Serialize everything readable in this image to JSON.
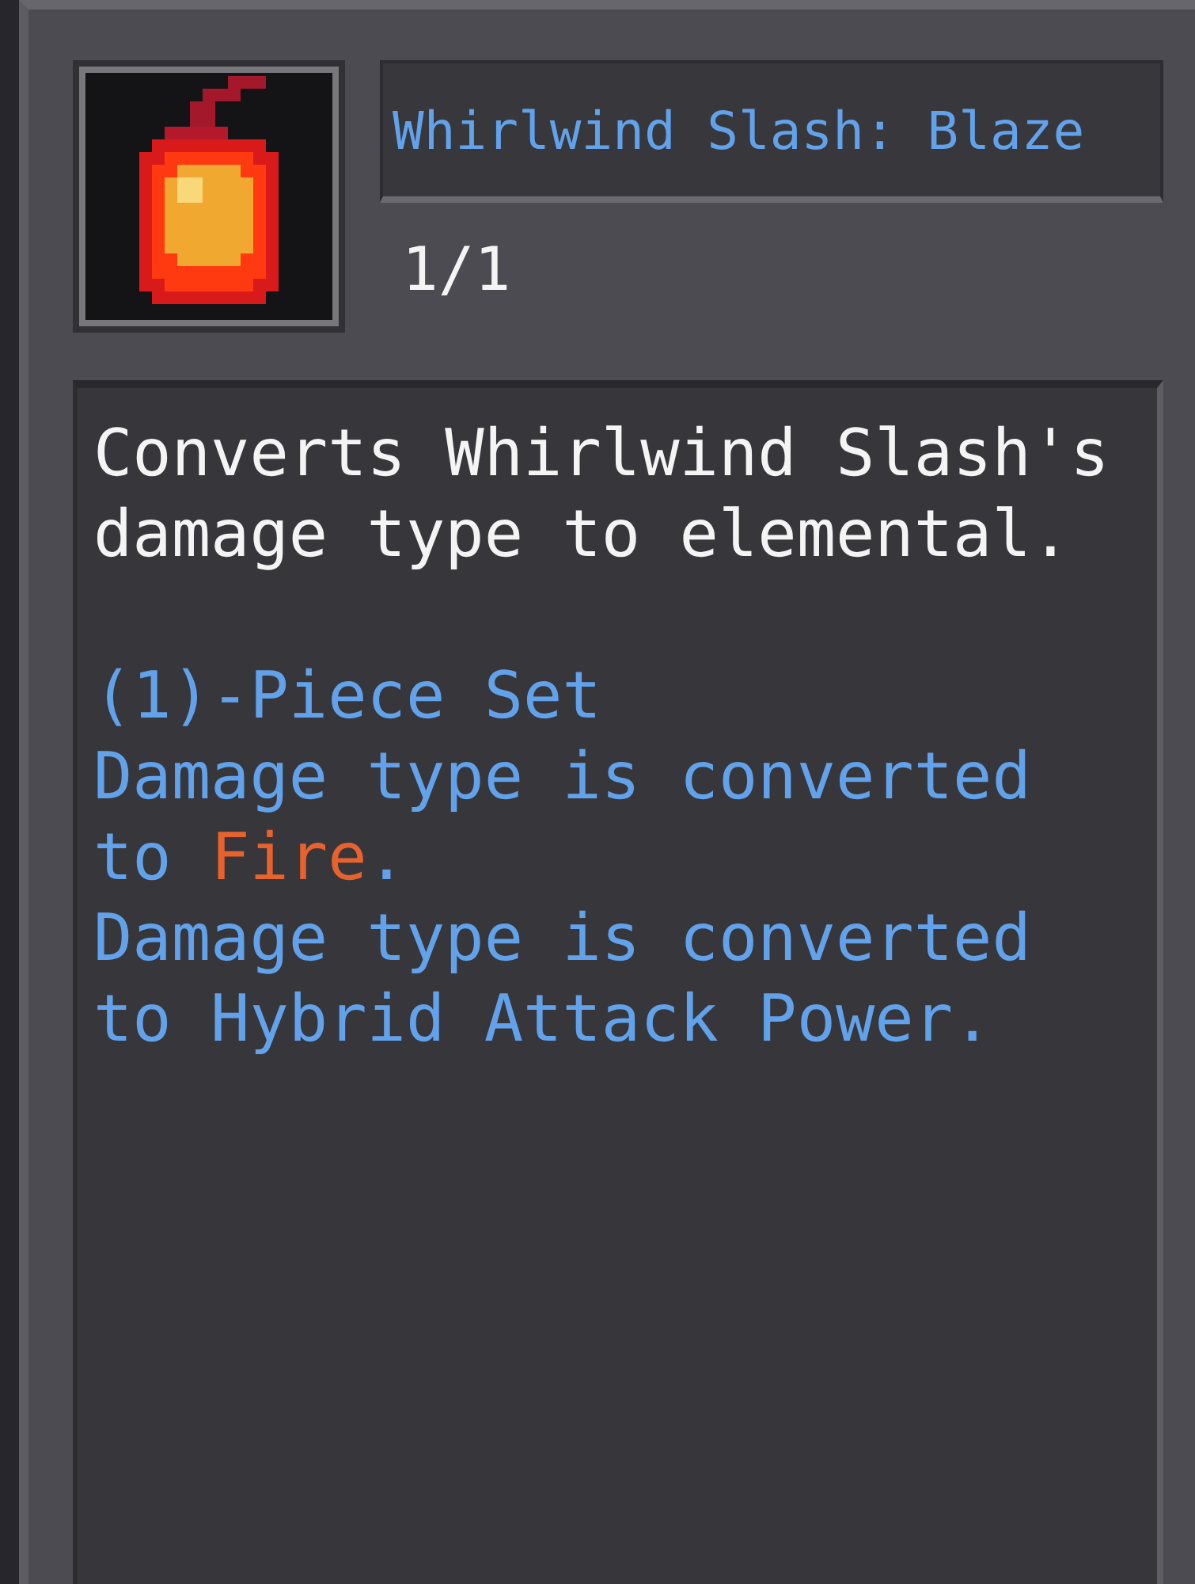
{
  "skill": {
    "name": "Whirlwind Slash: Blaze",
    "count": "1/1"
  },
  "description": "Converts Whirlwind Slash's damage type to elemental.",
  "set_bonus": {
    "title": "(1)-Piece Set",
    "effects": [
      {
        "segments": [
          {
            "text": "Damage type is converted to ",
            "color": "#62a2ea"
          },
          {
            "text": "Fire",
            "color": "#e8622e"
          },
          {
            "text": ".",
            "color": "#62a2ea"
          }
        ]
      },
      {
        "segments": [
          {
            "text": "Damage type is converted to Hybrid Attack Power.",
            "color": "#62a2ea"
          }
        ]
      }
    ]
  }
}
